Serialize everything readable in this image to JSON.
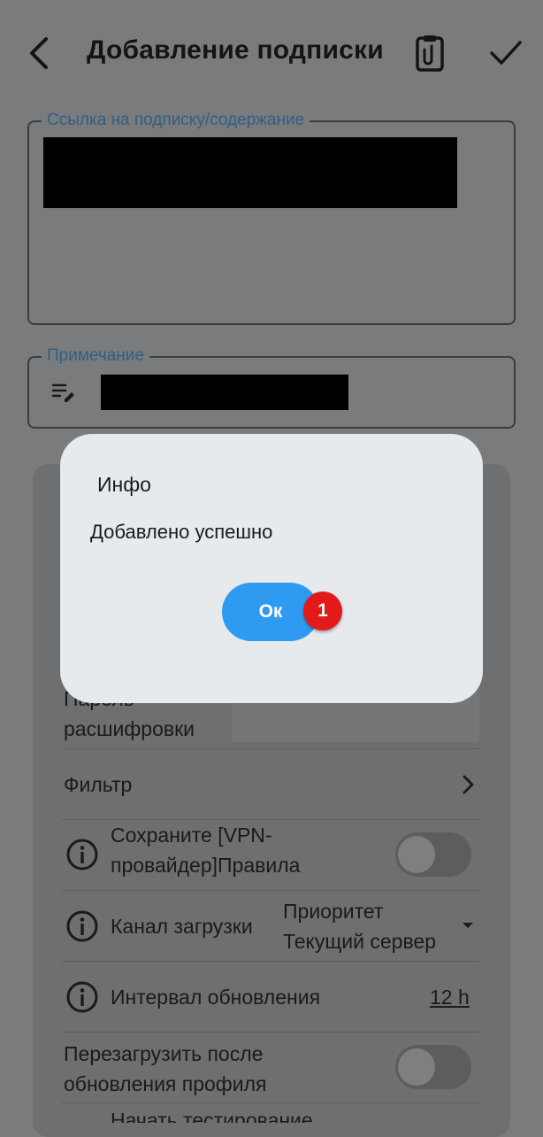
{
  "header": {
    "title": "Добавление подписки"
  },
  "form": {
    "subscription_label": "Ссылка на подписку/содержание",
    "note_label": "Примечание"
  },
  "settings": {
    "password_label": "Пароль расшифровки",
    "filter_label": "Фильтр",
    "save_rules_label": "Сохраните [VPN-провайдер]Правила",
    "channel_label": "Канал загрузки",
    "channel_value": "Приоритет Текущий сервер",
    "interval_label": "Интервал обновления",
    "interval_value": "12 h",
    "reload_label": "Перезагрузить после обновления профиля",
    "start_test_label": "Начать тестирование"
  },
  "dialog": {
    "title": "Инфо",
    "message": "Добавлено успешно",
    "ok_label": "Ок",
    "badge": "1"
  },
  "colors": {
    "accent": "#2f9bf0",
    "badge": "#e21a1a",
    "label": "#2f5f86"
  }
}
